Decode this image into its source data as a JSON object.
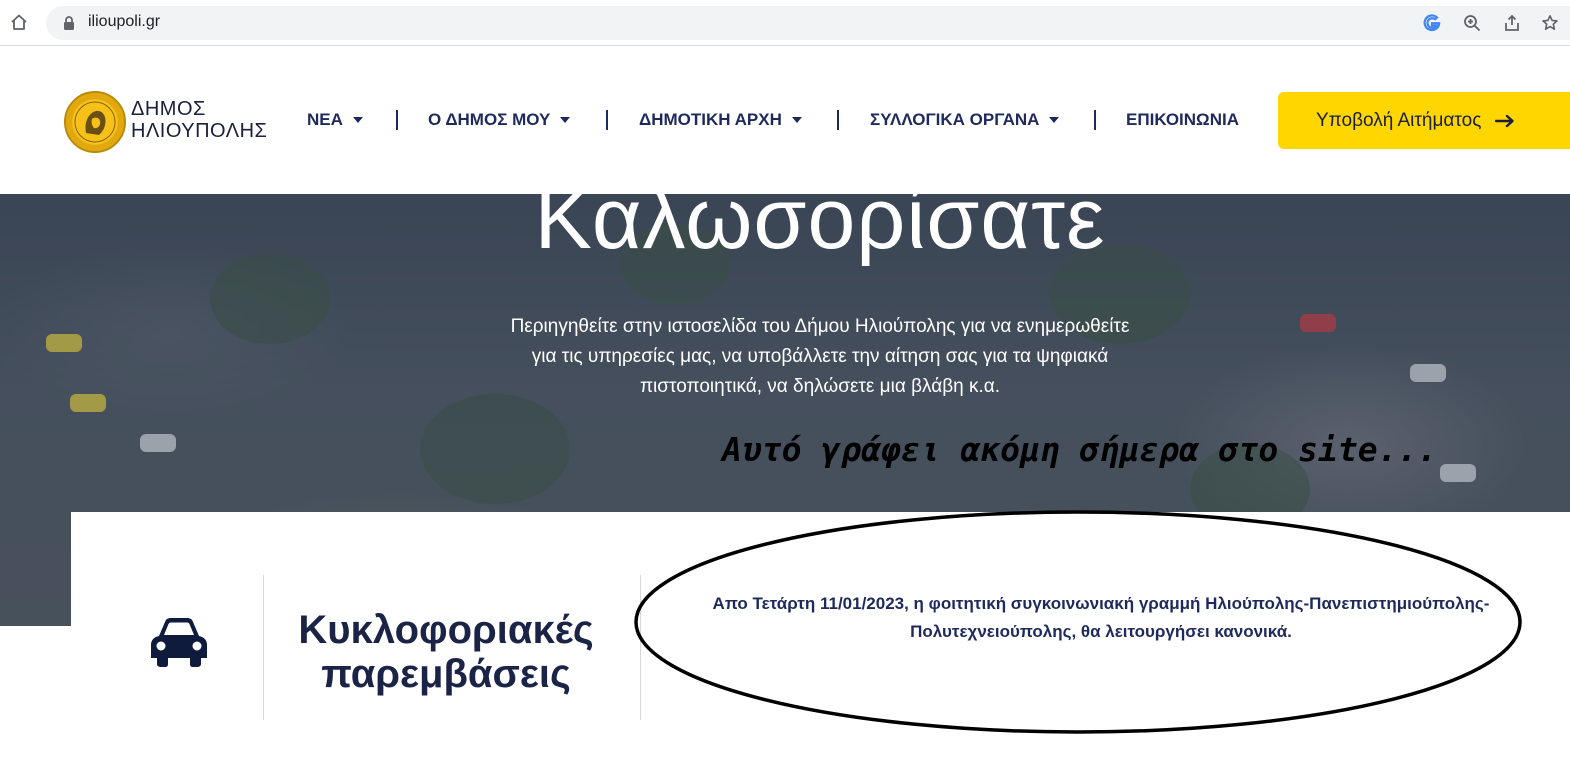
{
  "browser": {
    "url": "ilioupoli.gr"
  },
  "header": {
    "logo_line1": "ΔΗΜΟΣ",
    "logo_line2": "ΗΛΙΟΥΠΟΛΗΣ",
    "nav": [
      {
        "label": "ΝΕΑ",
        "has_dropdown": true
      },
      {
        "label": "Ο ΔΗΜΟΣ ΜΟΥ",
        "has_dropdown": true
      },
      {
        "label": "ΔΗΜΟΤΙΚΗ ΑΡΧΗ",
        "has_dropdown": true
      },
      {
        "label": "ΣΥΛΛΟΓΙΚΑ ΟΡΓΑΝΑ",
        "has_dropdown": true
      },
      {
        "label": "ΕΠΙΚΟΙΝΩΝΙΑ",
        "has_dropdown": false
      }
    ],
    "submit_label": "Υποβολή Αιτήματος"
  },
  "hero": {
    "title": "Καλωσορίσατε",
    "text": "Περιηγηθείτε στην ιστοσελίδα του Δήμου Ηλιούπολης για να ενημερωθείτε για τις υπηρεσίες μας, να υποβάλλετε την αίτηση σας για τα ψηφιακά πιστοποιητικά, να δηλώσετε μια βλάβη κ.α."
  },
  "annotation": {
    "text": "Αυτό γράφει ακόμη σήμερα στο site..."
  },
  "card": {
    "title": "Κυκλοφοριακές παρεμβάσεις",
    "text": "Απο Τετάρτη 11/01/2023, η φοιτητική συγκοινωνιακή γραμμή  Ηλιούπολης-Πανεπιστημιούπολης-Πολυτεχνειούπολης, θα λειτουργήσει κανονικά."
  },
  "colors": {
    "accent_yellow": "#ffd600",
    "navy": "#1f2a5c"
  }
}
